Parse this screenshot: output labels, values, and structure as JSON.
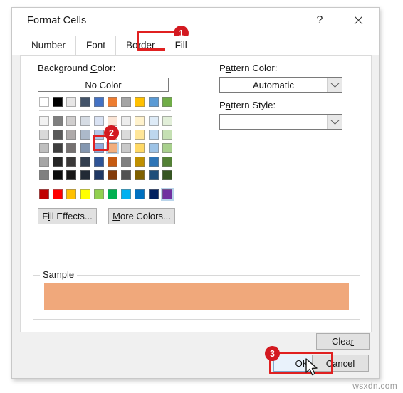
{
  "window": {
    "title": "Format Cells",
    "help_icon": "?",
    "close_icon": "close-icon"
  },
  "tabs": [
    {
      "label": "Number",
      "active": false
    },
    {
      "label": "Font",
      "active": false
    },
    {
      "label": "Border",
      "active": false
    },
    {
      "label": "Fill",
      "active": true
    }
  ],
  "fill_tab": {
    "background_color_label": "Background Color:",
    "no_color_label": "No Color",
    "pattern_color_label": "Pattern Color:",
    "pattern_color_value": "Automatic",
    "pattern_style_label": "Pattern Style:",
    "pattern_style_value": "",
    "fill_effects_label": "Fill Effects...",
    "more_colors_label": "More Colors...",
    "sample_label": "Sample",
    "sample_fill_color": "#F0A87B",
    "selected_swatch": {
      "grid": "tints",
      "row": 2,
      "col": 5,
      "color": "#F2AE7D"
    }
  },
  "palette": {
    "standard_row": [
      "#FFFFFF",
      "#000000",
      "#E7E6E6",
      "#44546A",
      "#4472C4",
      "#ED7D31",
      "#A5A5A5",
      "#FFC000",
      "#5B9BD5",
      "#70AD47"
    ],
    "tint_rows": [
      [
        "#F2F2F2",
        "#7F7F7F",
        "#D0CECE",
        "#D6DCE4",
        "#D9E2F3",
        "#FBE5D6",
        "#EDEDED",
        "#FFF2CC",
        "#DEEBF7",
        "#E2EFD9"
      ],
      [
        "#D9D9D9",
        "#595959",
        "#AEAAAA",
        "#ACB9CA",
        "#B4C7E7",
        "#F7CBAC",
        "#DBDBDB",
        "#FFE699",
        "#BDD7EE",
        "#C5E0B3"
      ],
      [
        "#BFBFBF",
        "#3F3F3F",
        "#757171",
        "#8497B0",
        "#8FAADC",
        "#F2AE7D",
        "#C9C9C9",
        "#FFD966",
        "#9DC3E6",
        "#A8D08D"
      ],
      [
        "#A6A6A6",
        "#262626",
        "#3A3838",
        "#333F4F",
        "#2F5496",
        "#C55A11",
        "#808080",
        "#BF8F00",
        "#2E75B6",
        "#538135"
      ],
      [
        "#808080",
        "#0D0D0D",
        "#181717",
        "#222A35",
        "#1F3864",
        "#833C0B",
        "#525252",
        "#7F6000",
        "#1F4E79",
        "#375623"
      ]
    ],
    "standard_colors_row": [
      "#C00000",
      "#FF0000",
      "#FFC000",
      "#FFFF00",
      "#92D050",
      "#00B050",
      "#00B0F0",
      "#0070C0",
      "#002060",
      "#7030A0"
    ]
  },
  "footer": {
    "clear_label": "Clear",
    "ok_label": "OK",
    "cancel_label": "Cancel"
  },
  "annotations": {
    "step1": "1",
    "step2": "2",
    "step3": "3"
  },
  "watermark": "wsxdn.com"
}
